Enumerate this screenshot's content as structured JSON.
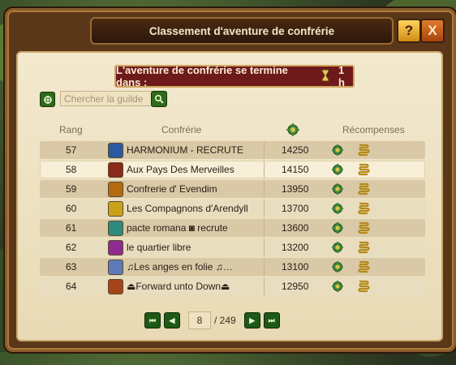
{
  "window": {
    "title": "Classement d'aventure de confrérie",
    "help_label": "?",
    "close_label": "X"
  },
  "timer": {
    "label": "L'aventure de confrérie se termine dans :",
    "value": "1 h"
  },
  "search": {
    "placeholder": "Chercher la guilde"
  },
  "table": {
    "headers": {
      "rank": "Rang",
      "guild": "Confrérie",
      "points_icon": "points-icon",
      "rewards": "Récompenses"
    },
    "rows": [
      {
        "rank": "57",
        "name": "HARMONIUM - RECRUTE",
        "points": "14250",
        "emblem_color": "#2c5a9e",
        "highlight": false
      },
      {
        "rank": "58",
        "name": "Aux Pays Des Merveilles",
        "points": "14150",
        "emblem_color": "#8a2a1a",
        "highlight": true
      },
      {
        "rank": "59",
        "name": "Confrerie d' Evendim",
        "points": "13950",
        "emblem_color": "#b56a12",
        "highlight": false
      },
      {
        "rank": "60",
        "name": "Les Compagnons d'Arendyll",
        "points": "13700",
        "emblem_color": "#caa21a",
        "highlight": false
      },
      {
        "rank": "61",
        "name": "pacte romana ◙ recrute",
        "points": "13600",
        "emblem_color": "#2e8a7a",
        "highlight": false
      },
      {
        "rank": "62",
        "name": "le quartier libre",
        "points": "13200",
        "emblem_color": "#8e2b8e",
        "highlight": false
      },
      {
        "rank": "63",
        "name": "♫Les anges en folie ♫…",
        "points": "13100",
        "emblem_color": "#5d7ab8",
        "highlight": false
      },
      {
        "rank": "64",
        "name": "⏏Forward unto Down⏏",
        "points": "12950",
        "emblem_color": "#a5441a",
        "highlight": false
      }
    ]
  },
  "pager": {
    "first_label": "⏮",
    "prev_label": "◀",
    "page": "8",
    "total": "/ 249",
    "next_label": "▶",
    "last_label": "⏭"
  },
  "colors": {
    "frame": "#5a3718",
    "parchment": "#f3e9cf",
    "timer_bg": "#6e1a1a",
    "button_green": "#1e5a16"
  }
}
